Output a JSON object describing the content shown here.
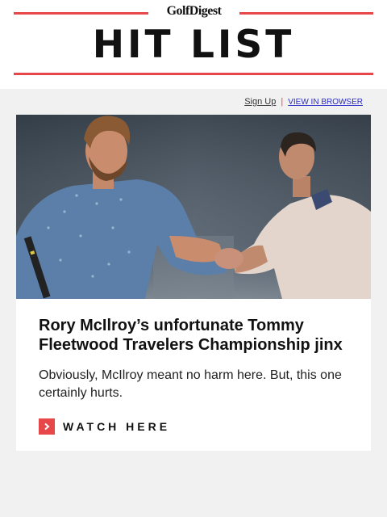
{
  "header": {
    "brand": "GolfDigest",
    "masthead": "HIT LIST"
  },
  "links": {
    "signup": "Sign Up",
    "separator": "|",
    "view_in_browser": "VIEW IN BROWSER"
  },
  "article": {
    "image_icon": "photo-handshake",
    "headline": "Rory McIlroy’s unfortunate Tommy Fleetwood Travelers Championship jinx",
    "dek": "Obviously, McIlroy meant no harm here. But, this one certainly hurts.",
    "cta_label": "WATCH HERE",
    "cta_icon": "chevron-right-icon"
  },
  "colors": {
    "accent": "#e8474a",
    "page_bg": "#f1f1f1",
    "card_bg": "#ffffff",
    "link_blue": "#2a2ac8"
  }
}
